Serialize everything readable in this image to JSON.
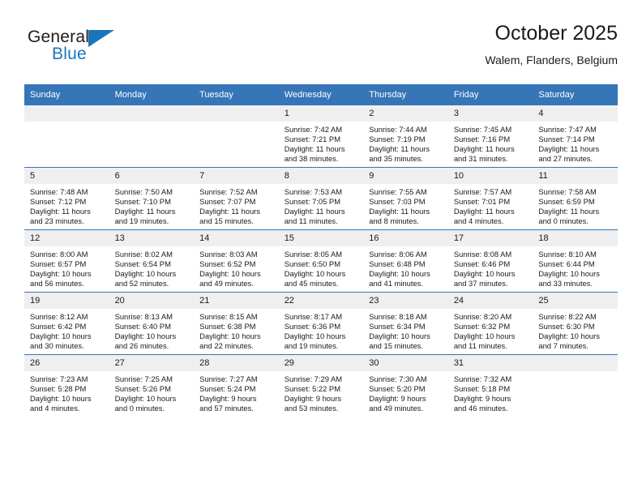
{
  "brand": {
    "name_part1": "General",
    "name_part2": "Blue",
    "flag_icon": "triangle-flag-icon"
  },
  "header": {
    "title": "October 2025",
    "location": "Walem, Flanders, Belgium"
  },
  "colors": {
    "header_blue": "#3575b8",
    "brand_blue": "#1b75bb",
    "daynum_strip": "#efefef",
    "text": "#1a1a1a"
  },
  "calendar": {
    "weekday_headers": [
      "Sunday",
      "Monday",
      "Tuesday",
      "Wednesday",
      "Thursday",
      "Friday",
      "Saturday"
    ],
    "weeks": [
      [
        {
          "day": "",
          "lines": []
        },
        {
          "day": "",
          "lines": []
        },
        {
          "day": "",
          "lines": []
        },
        {
          "day": "1",
          "lines": [
            "Sunrise: 7:42 AM",
            "Sunset: 7:21 PM",
            "Daylight: 11 hours",
            "and 38 minutes."
          ]
        },
        {
          "day": "2",
          "lines": [
            "Sunrise: 7:44 AM",
            "Sunset: 7:19 PM",
            "Daylight: 11 hours",
            "and 35 minutes."
          ]
        },
        {
          "day": "3",
          "lines": [
            "Sunrise: 7:45 AM",
            "Sunset: 7:16 PM",
            "Daylight: 11 hours",
            "and 31 minutes."
          ]
        },
        {
          "day": "4",
          "lines": [
            "Sunrise: 7:47 AM",
            "Sunset: 7:14 PM",
            "Daylight: 11 hours",
            "and 27 minutes."
          ]
        }
      ],
      [
        {
          "day": "5",
          "lines": [
            "Sunrise: 7:48 AM",
            "Sunset: 7:12 PM",
            "Daylight: 11 hours",
            "and 23 minutes."
          ]
        },
        {
          "day": "6",
          "lines": [
            "Sunrise: 7:50 AM",
            "Sunset: 7:10 PM",
            "Daylight: 11 hours",
            "and 19 minutes."
          ]
        },
        {
          "day": "7",
          "lines": [
            "Sunrise: 7:52 AM",
            "Sunset: 7:07 PM",
            "Daylight: 11 hours",
            "and 15 minutes."
          ]
        },
        {
          "day": "8",
          "lines": [
            "Sunrise: 7:53 AM",
            "Sunset: 7:05 PM",
            "Daylight: 11 hours",
            "and 11 minutes."
          ]
        },
        {
          "day": "9",
          "lines": [
            "Sunrise: 7:55 AM",
            "Sunset: 7:03 PM",
            "Daylight: 11 hours",
            "and 8 minutes."
          ]
        },
        {
          "day": "10",
          "lines": [
            "Sunrise: 7:57 AM",
            "Sunset: 7:01 PM",
            "Daylight: 11 hours",
            "and 4 minutes."
          ]
        },
        {
          "day": "11",
          "lines": [
            "Sunrise: 7:58 AM",
            "Sunset: 6:59 PM",
            "Daylight: 11 hours",
            "and 0 minutes."
          ]
        }
      ],
      [
        {
          "day": "12",
          "lines": [
            "Sunrise: 8:00 AM",
            "Sunset: 6:57 PM",
            "Daylight: 10 hours",
            "and 56 minutes."
          ]
        },
        {
          "day": "13",
          "lines": [
            "Sunrise: 8:02 AM",
            "Sunset: 6:54 PM",
            "Daylight: 10 hours",
            "and 52 minutes."
          ]
        },
        {
          "day": "14",
          "lines": [
            "Sunrise: 8:03 AM",
            "Sunset: 6:52 PM",
            "Daylight: 10 hours",
            "and 49 minutes."
          ]
        },
        {
          "day": "15",
          "lines": [
            "Sunrise: 8:05 AM",
            "Sunset: 6:50 PM",
            "Daylight: 10 hours",
            "and 45 minutes."
          ]
        },
        {
          "day": "16",
          "lines": [
            "Sunrise: 8:06 AM",
            "Sunset: 6:48 PM",
            "Daylight: 10 hours",
            "and 41 minutes."
          ]
        },
        {
          "day": "17",
          "lines": [
            "Sunrise: 8:08 AM",
            "Sunset: 6:46 PM",
            "Daylight: 10 hours",
            "and 37 minutes."
          ]
        },
        {
          "day": "18",
          "lines": [
            "Sunrise: 8:10 AM",
            "Sunset: 6:44 PM",
            "Daylight: 10 hours",
            "and 33 minutes."
          ]
        }
      ],
      [
        {
          "day": "19",
          "lines": [
            "Sunrise: 8:12 AM",
            "Sunset: 6:42 PM",
            "Daylight: 10 hours",
            "and 30 minutes."
          ]
        },
        {
          "day": "20",
          "lines": [
            "Sunrise: 8:13 AM",
            "Sunset: 6:40 PM",
            "Daylight: 10 hours",
            "and 26 minutes."
          ]
        },
        {
          "day": "21",
          "lines": [
            "Sunrise: 8:15 AM",
            "Sunset: 6:38 PM",
            "Daylight: 10 hours",
            "and 22 minutes."
          ]
        },
        {
          "day": "22",
          "lines": [
            "Sunrise: 8:17 AM",
            "Sunset: 6:36 PM",
            "Daylight: 10 hours",
            "and 19 minutes."
          ]
        },
        {
          "day": "23",
          "lines": [
            "Sunrise: 8:18 AM",
            "Sunset: 6:34 PM",
            "Daylight: 10 hours",
            "and 15 minutes."
          ]
        },
        {
          "day": "24",
          "lines": [
            "Sunrise: 8:20 AM",
            "Sunset: 6:32 PM",
            "Daylight: 10 hours",
            "and 11 minutes."
          ]
        },
        {
          "day": "25",
          "lines": [
            "Sunrise: 8:22 AM",
            "Sunset: 6:30 PM",
            "Daylight: 10 hours",
            "and 7 minutes."
          ]
        }
      ],
      [
        {
          "day": "26",
          "lines": [
            "Sunrise: 7:23 AM",
            "Sunset: 5:28 PM",
            "Daylight: 10 hours",
            "and 4 minutes."
          ]
        },
        {
          "day": "27",
          "lines": [
            "Sunrise: 7:25 AM",
            "Sunset: 5:26 PM",
            "Daylight: 10 hours",
            "and 0 minutes."
          ]
        },
        {
          "day": "28",
          "lines": [
            "Sunrise: 7:27 AM",
            "Sunset: 5:24 PM",
            "Daylight: 9 hours",
            "and 57 minutes."
          ]
        },
        {
          "day": "29",
          "lines": [
            "Sunrise: 7:29 AM",
            "Sunset: 5:22 PM",
            "Daylight: 9 hours",
            "and 53 minutes."
          ]
        },
        {
          "day": "30",
          "lines": [
            "Sunrise: 7:30 AM",
            "Sunset: 5:20 PM",
            "Daylight: 9 hours",
            "and 49 minutes."
          ]
        },
        {
          "day": "31",
          "lines": [
            "Sunrise: 7:32 AM",
            "Sunset: 5:18 PM",
            "Daylight: 9 hours",
            "and 46 minutes."
          ]
        },
        {
          "day": "",
          "lines": []
        }
      ]
    ]
  }
}
